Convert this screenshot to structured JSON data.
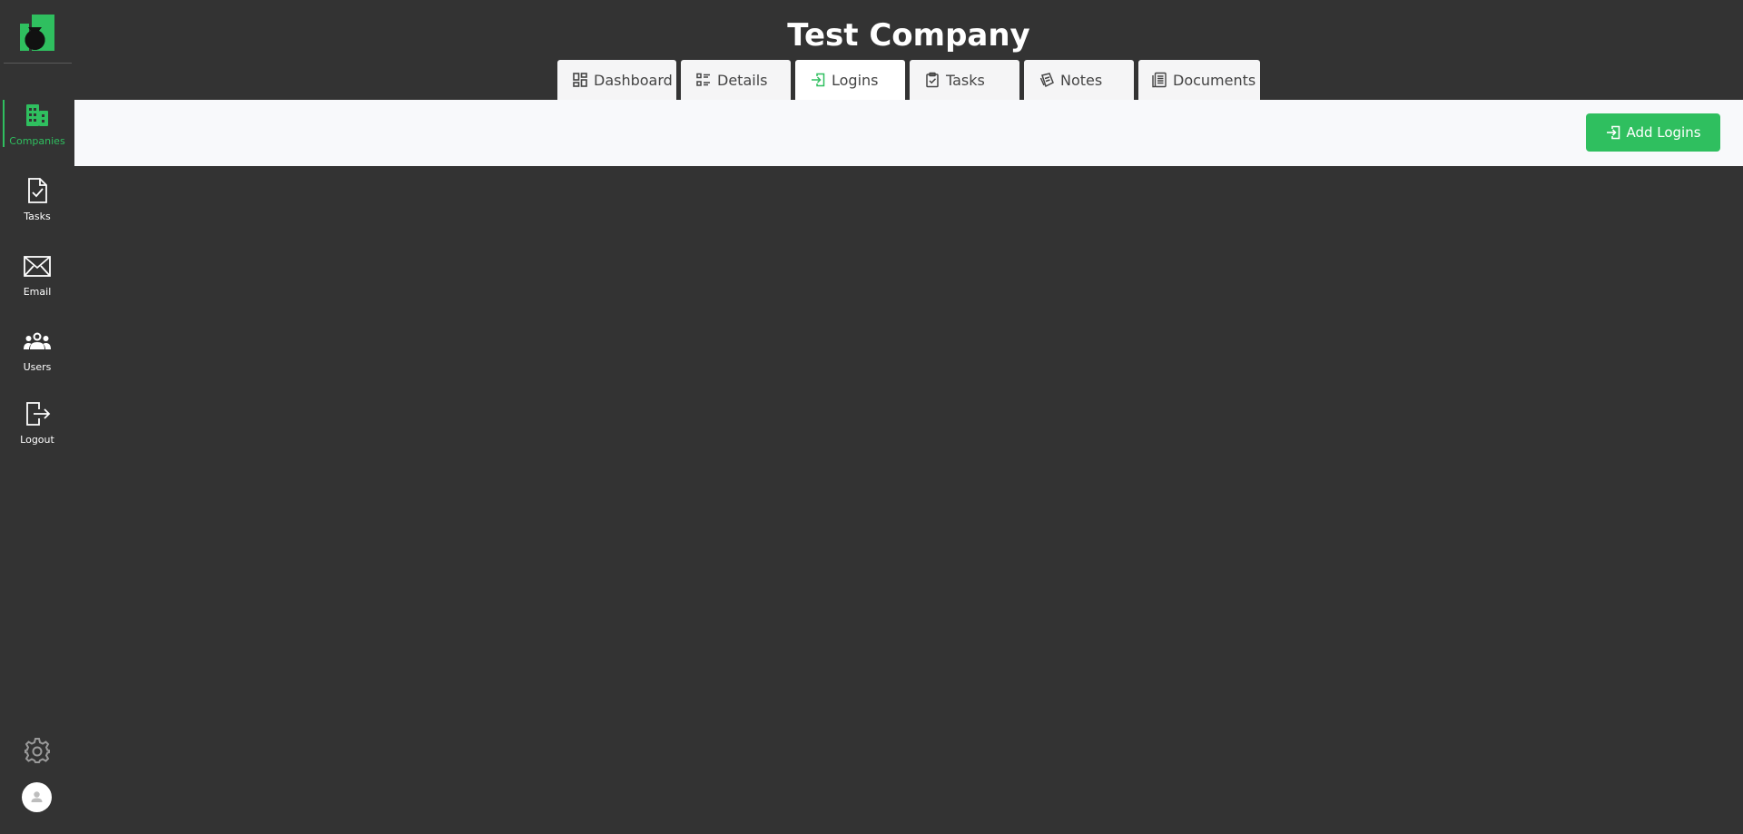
{
  "colors": {
    "background": "#333333",
    "accent": "#2fbf5f",
    "tab_bg": "#f5f5f6",
    "content_bar_bg": "#f8f9fb"
  },
  "page": {
    "title": "Test Company"
  },
  "sidebar": {
    "logo_icon": "company-logo-icon",
    "items": [
      {
        "label": "Companies",
        "icon": "building-icon",
        "active": true
      },
      {
        "label": "Tasks",
        "icon": "document-check-icon",
        "active": false
      },
      {
        "label": "Email",
        "icon": "envelope-icon",
        "active": false
      },
      {
        "label": "Users",
        "icon": "users-icon",
        "active": false
      },
      {
        "label": "Logout",
        "icon": "logout-icon",
        "active": false
      }
    ],
    "settings_icon": "gear-icon",
    "avatar_icon": "user-avatar-icon"
  },
  "tabs": [
    {
      "label": "Dashboard",
      "icon": "dashboard-icon",
      "active": false
    },
    {
      "label": "Details",
      "icon": "list-details-icon",
      "active": false
    },
    {
      "label": "Logins",
      "icon": "login-icon",
      "active": true
    },
    {
      "label": "Tasks",
      "icon": "clipboard-check-icon",
      "active": false
    },
    {
      "label": "Notes",
      "icon": "notes-icon",
      "active": false
    },
    {
      "label": "Documents",
      "icon": "documents-icon",
      "active": false
    }
  ],
  "toolbar": {
    "add_button_label": "Add Logins",
    "add_button_icon": "login-icon"
  }
}
